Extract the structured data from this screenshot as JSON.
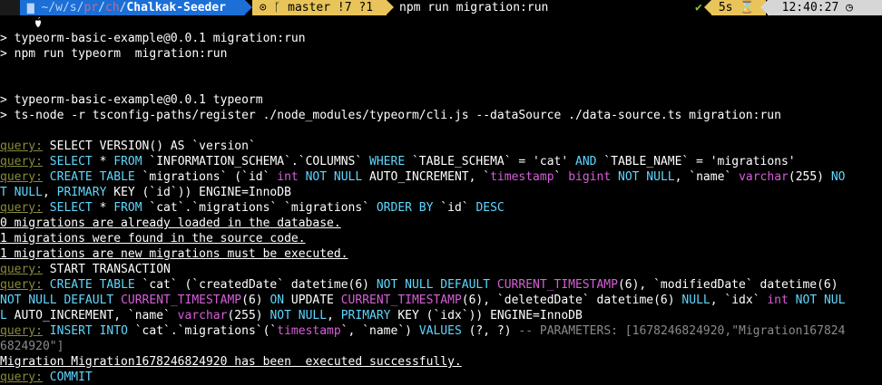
{
  "prompt": {
    "os_icon": "apple-icon",
    "dir_prefix": "~/w/s/",
    "dir_mid": "pr",
    "dir_sep": "/",
    "dir_mid2": "ch",
    "dir_last": "Chalkak-Seeder",
    "git_icon": "git-icon",
    "git_branch": "master",
    "git_status": "!7 ?1",
    "command": "npm run migration:run",
    "check": "✔",
    "duration": "5s",
    "duration_icon": "hourglass-icon",
    "time": "12:40:27",
    "time_icon": "clock-icon"
  },
  "lines": {
    "l1": "> typeorm-basic-example@0.0.1 migration:run",
    "l2": "> npm run typeorm  migration:run",
    "l3": "> typeorm-basic-example@0.0.1 typeorm",
    "l4": "> ts-node -r tsconfig-paths/register ./node_modules/typeorm/cli.js --dataSource ./data-source.ts migration:run",
    "q1": "query:",
    "s1": " SELECT VERSION() AS `version`",
    "q2": "query:",
    "q3": "query:",
    "q4": "query:",
    "m1": "0 migrations are already loaded in the database.",
    "m2": "1 migrations were found in the source code.",
    "m3": "1 migrations are new migrations must be executed.",
    "q5": "query:",
    "s5": " START TRANSACTION",
    "q6": "query:",
    "q7": "query:",
    "params": " -- PARAMETERS: [1678246824920,\"Migration167824",
    "params2": "6824920\"]",
    "m4": "Migration Migration1678246824920 has been  executed successfully.",
    "q8": "query:",
    "s8": " COMMIT"
  }
}
